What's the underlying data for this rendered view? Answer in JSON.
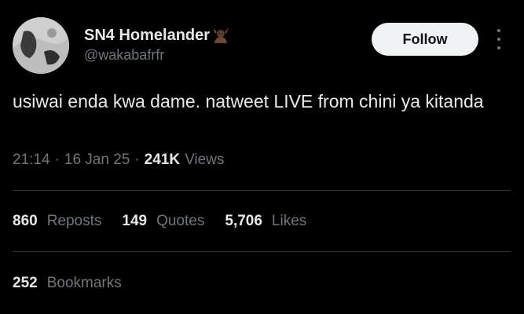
{
  "user": {
    "display_name": "SN4 Homelander",
    "handle": "@wakabafrfr"
  },
  "follow_label": "Follow",
  "tweet": {
    "text": "usiwai enda kwa dame. natweet LIVE from chini ya kitanda"
  },
  "meta": {
    "time": "21:14",
    "separator": "·",
    "date": "16 Jan 25",
    "views_count": "241K",
    "views_label": "Views"
  },
  "stats": {
    "reposts": {
      "count": "860",
      "label": "Reposts"
    },
    "quotes": {
      "count": "149",
      "label": "Quotes"
    },
    "likes": {
      "count": "5,706",
      "label": "Likes"
    },
    "bookmarks": {
      "count": "252",
      "label": "Bookmarks"
    }
  },
  "icons": {
    "avatar": "profile-avatar",
    "badge": "horned-emoji-icon",
    "more": "more-vertical-icon"
  },
  "colors": {
    "background": "#000000",
    "primary_text": "#e7e9ea",
    "secondary_text": "#71767b",
    "follow_button_bg": "#eff3f4",
    "follow_button_text": "#0f1419",
    "divider": "#2f3336"
  }
}
